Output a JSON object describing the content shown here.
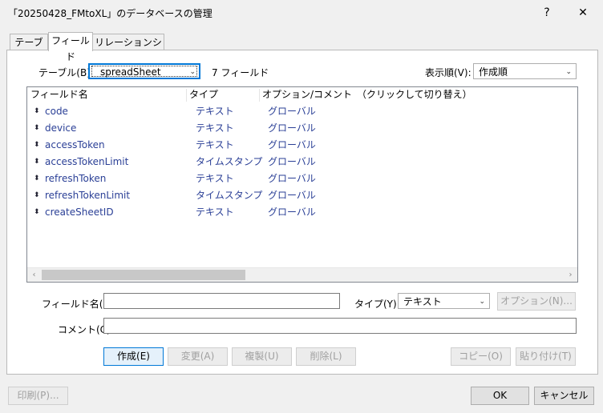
{
  "window": {
    "title": "「20250428_FMtoXL」のデータベースの管理",
    "help_label": "?",
    "close_label": "✕"
  },
  "tabs": [
    {
      "label": "テーブル"
    },
    {
      "label": "フィールド"
    },
    {
      "label": "リレーションシップ"
    }
  ],
  "table_selector": {
    "label": "テーブル(B):",
    "value": "spreadSheet",
    "field_count": "7 フィールド"
  },
  "sort": {
    "label": "表示順(V):",
    "value": "作成順"
  },
  "field_list": {
    "headers": {
      "name": "フィールド名",
      "type": "タイプ",
      "options": "オプション/コメント　（クリックして切り替え）"
    },
    "rows": [
      {
        "name": "code",
        "type": "テキスト",
        "options": "グローバル"
      },
      {
        "name": "device",
        "type": "テキスト",
        "options": "グローバル"
      },
      {
        "name": "accessToken",
        "type": "テキスト",
        "options": "グローバル"
      },
      {
        "name": "accessTokenLimit",
        "type": "タイムスタンプ",
        "options": "グローバル"
      },
      {
        "name": "refreshToken",
        "type": "テキスト",
        "options": "グローバル"
      },
      {
        "name": "refreshTokenLimit",
        "type": "タイムスタンプ",
        "options": "グローバル"
      },
      {
        "name": "createSheetID",
        "type": "テキスト",
        "options": "グローバル"
      }
    ]
  },
  "field_editor": {
    "name_label": "フィールド名(F):",
    "name_value": "",
    "type_label": "タイプ(Y):",
    "type_value": "テキスト",
    "options_button": "オプション(N)...",
    "comment_label": "コメント(C):",
    "comment_value": ""
  },
  "actions": {
    "create": "作成(E)",
    "change": "変更(A)",
    "duplicate": "複製(U)",
    "delete": "削除(L)",
    "copy": "コピー(O)",
    "paste": "貼り付け(T)"
  },
  "footer": {
    "print": "印刷(P)...",
    "ok": "OK",
    "cancel": "キャンセル"
  },
  "icons": {
    "dropdown": "chevron-down-icon",
    "row_marker": "updown-arrows-icon",
    "scroll_left": "chevron-left-icon",
    "scroll_right": "chevron-right-icon"
  }
}
